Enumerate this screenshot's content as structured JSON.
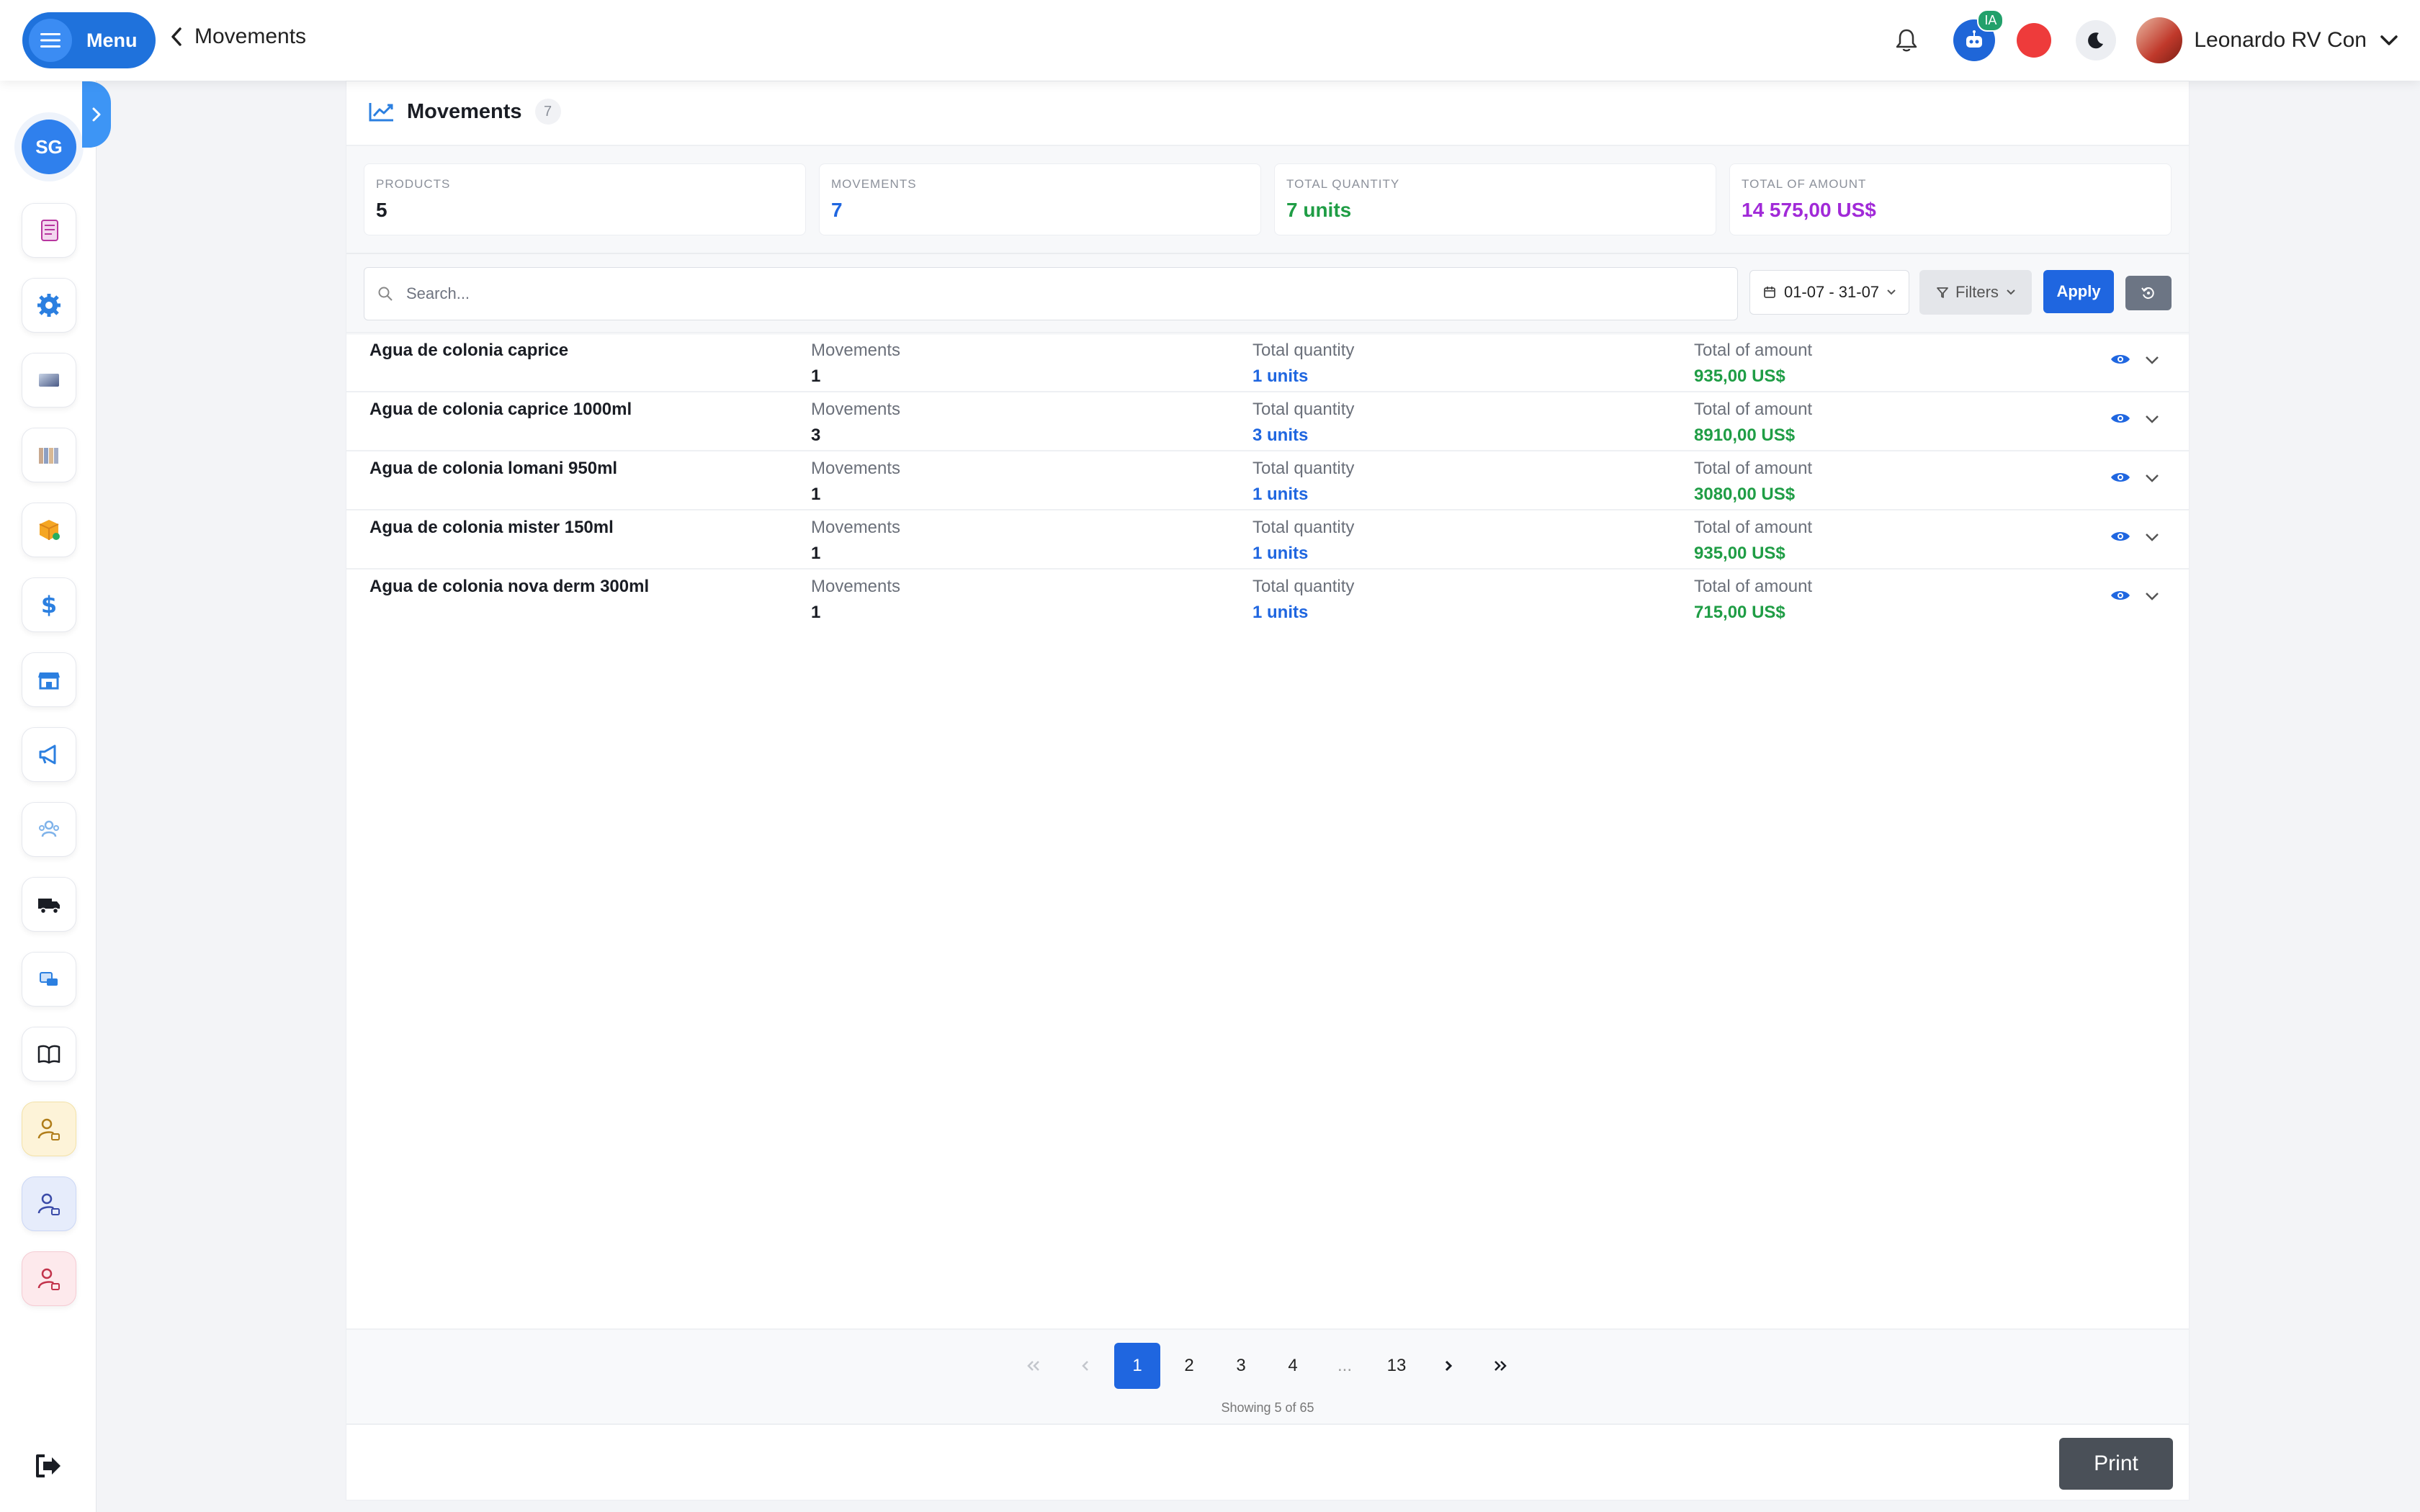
{
  "header": {
    "menu_label": "Menu",
    "breadcrumb": "Movements",
    "ai_badge": "IA",
    "user_name": "Leonardo RV Con"
  },
  "sidebar": {
    "initials": "SG"
  },
  "page": {
    "title": "Movements",
    "count": "7"
  },
  "stats": [
    {
      "label": "PRODUCTS",
      "value": "5",
      "color": "#1a1d24"
    },
    {
      "label": "MOVEMENTS",
      "value": "7",
      "color": "#1f66e0"
    },
    {
      "label": "TOTAL QUANTITY",
      "value": "7 units",
      "color": "#1f9d45"
    },
    {
      "label": "TOTAL OF AMOUNT",
      "value": "14 575,00 US$",
      "color": "#a12ad8"
    }
  ],
  "toolbar": {
    "search_placeholder": "Search...",
    "date_range": "01-07 - 31-07",
    "filters_label": "Filters",
    "apply_label": "Apply"
  },
  "columns": {
    "movements": "Movements",
    "quantity": "Total quantity",
    "amount": "Total of amount"
  },
  "rows": [
    {
      "name": "Agua de colonia caprice",
      "movements": "1",
      "quantity": "1 units",
      "amount": "935,00 US$"
    },
    {
      "name": "Agua de colonia caprice 1000ml",
      "movements": "3",
      "quantity": "3 units",
      "amount": "8910,00 US$"
    },
    {
      "name": "Agua de colonia lomani 950ml",
      "movements": "1",
      "quantity": "1 units",
      "amount": "3080,00 US$"
    },
    {
      "name": "Agua de colonia mister 150ml",
      "movements": "1",
      "quantity": "1 units",
      "amount": "935,00 US$"
    },
    {
      "name": "Agua de colonia nova derm 300ml",
      "movements": "1",
      "quantity": "1 units",
      "amount": "715,00 US$"
    }
  ],
  "pagination": {
    "pages": [
      "1",
      "2",
      "3",
      "4",
      "...",
      "13"
    ],
    "current": "1",
    "showing": "Showing 5 of 65"
  },
  "footer": {
    "print_label": "Print"
  }
}
